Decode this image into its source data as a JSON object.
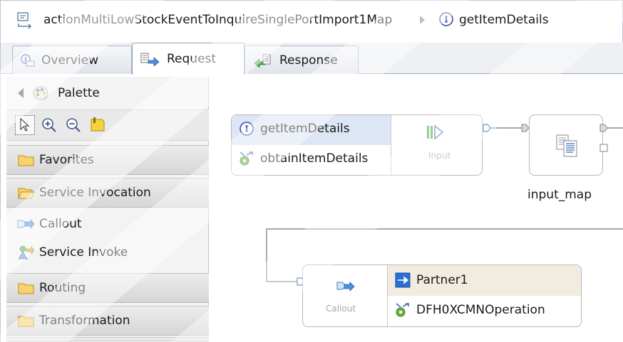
{
  "breadcrumb": {
    "map_name": "actionMultiLowStockEventToInquireSinglePortImport1Map",
    "operation": "getItemDetails",
    "icons": [
      "mediation-map-icon",
      "breadcrumb-separator-icon",
      "interface-operation-icon"
    ]
  },
  "tabs": [
    {
      "label": "Overview",
      "icon": "overview-icon",
      "active": false
    },
    {
      "label": "Request",
      "icon": "request-icon",
      "active": true
    },
    {
      "label": "Response",
      "icon": "response-icon",
      "active": false
    }
  ],
  "palette": {
    "title": "Palette",
    "tools": [
      "select-tool-icon",
      "zoom-in-icon",
      "zoom-out-icon",
      "note-icon"
    ],
    "drawers": {
      "favorites": "Favorites",
      "service_invocation": "Service Invocation",
      "routing": "Routing",
      "transformation": "Transformation"
    },
    "entries": {
      "callout": "Callout",
      "service_invoke": "Service Invoke"
    }
  },
  "canvas": {
    "input_node": {
      "operation": "getItemDetails",
      "reference": "obtainItemDetails",
      "primitive_label": "Input"
    },
    "input_map_label": "input_map",
    "callout_node": {
      "primitive_label": "Callout",
      "partner": "Partner1",
      "operation": "DFH0XCMNOperation"
    }
  },
  "colors": {
    "selected_row": "#dde6f4",
    "callout_header": "#f1ecdf",
    "connection": "#8c8c8c",
    "terminal_fill": "#ffffff",
    "terminal_stroke": "#3b6fb6",
    "accent": "#2a6fd6"
  }
}
